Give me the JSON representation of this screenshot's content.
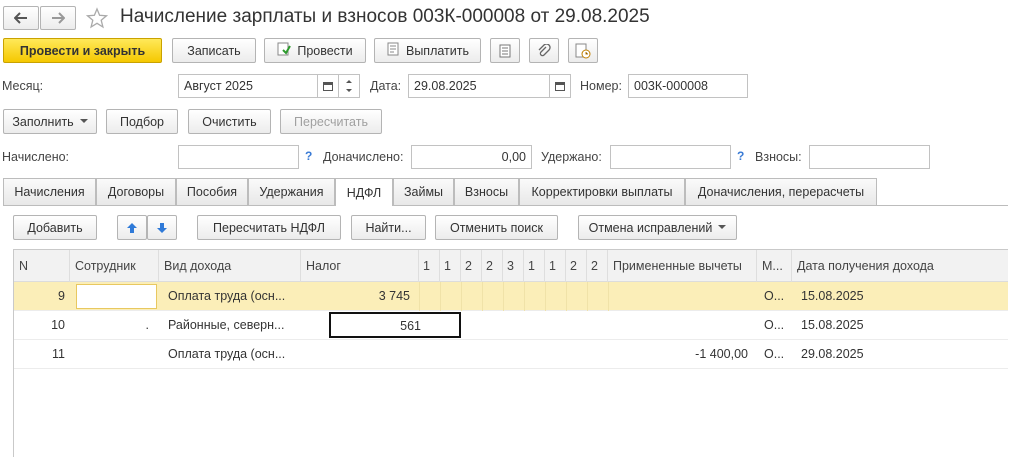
{
  "window": {
    "title": "Начисление зарплаты и взносов 003К-000008 от 29.08.2025"
  },
  "toolbar": {
    "post_close": "Провести и закрыть",
    "save": "Записать",
    "post": "Провести",
    "pay": "Выплатить"
  },
  "form": {
    "month_label": "Месяц:",
    "month_value": "Август 2025",
    "date_label": "Дата:",
    "date_value": "29.08.2025",
    "number_label": "Номер:",
    "number_value": "003К-000008"
  },
  "actions": {
    "fill": "Заполнить",
    "select": "Подбор",
    "clear": "Очистить",
    "recalc": "Пересчитать"
  },
  "totals": {
    "accrued_label": "Начислено:",
    "accrued_value": "",
    "extra_label": "Доначислено:",
    "extra_value": "0,00",
    "withheld_label": "Удержано:",
    "withheld_value": "",
    "contrib_label": "Взносы:",
    "contrib_value": "",
    "help": "?"
  },
  "tabs": [
    "Начисления",
    "Договоры",
    "Пособия",
    "Удержания",
    "НДФЛ",
    "Займы",
    "Взносы",
    "Корректировки выплаты",
    "Доначисления, перерасчеты"
  ],
  "grid_toolbar": {
    "add": "Добавить",
    "recalc_ndfl": "Пересчитать НДФЛ",
    "find": "Найти...",
    "cancel_search": "Отменить поиск",
    "cancel_fix": "Отмена исправлений"
  },
  "grid": {
    "headers": [
      "N",
      "Сотрудник",
      "Вид дохода",
      "Налог",
      "1",
      "1",
      "2",
      "2",
      "3",
      "1",
      "1",
      "2",
      "2",
      "Примененные вычеты",
      "М...",
      "Дата получения дохода"
    ],
    "rows": [
      {
        "n": "9",
        "employee": "",
        "income": "Оплата труда (осн...",
        "tax": "3 745",
        "deductions": "",
        "m": "О...",
        "date": "15.08.2025"
      },
      {
        "n": "10",
        "employee": ".",
        "income": "Районные, северн...",
        "tax": "561",
        "deductions": "",
        "m": "О...",
        "date": "15.08.2025"
      },
      {
        "n": "11",
        "employee": "",
        "income": "Оплата труда (осн...",
        "tax": "",
        "deductions": "-1 400,00",
        "m": "О...",
        "date": "29.08.2025"
      }
    ]
  }
}
